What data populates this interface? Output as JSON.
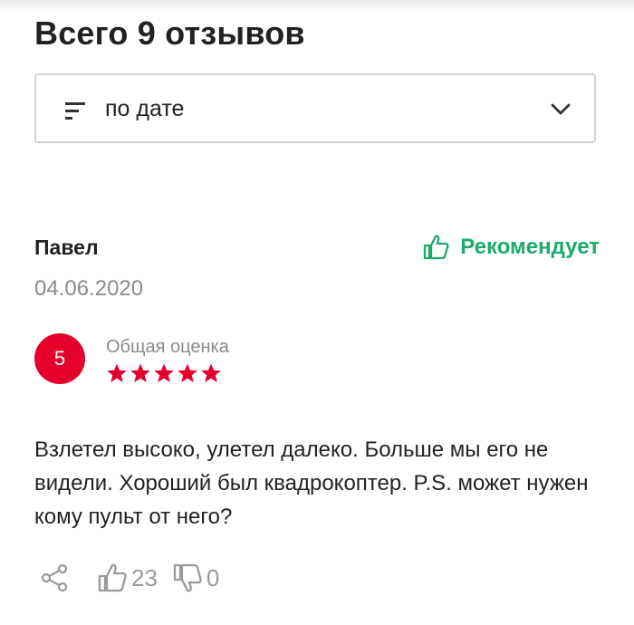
{
  "header": {
    "title": "Всего 9 отзывов"
  },
  "sort": {
    "selected": "по дате"
  },
  "review": {
    "author": "Павел",
    "date": "04.06.2020",
    "recommend_label": "Рекомендует",
    "score": "5",
    "score_label": "Общая оценка",
    "stars": 5,
    "text": "Взлетел высоко, улетел далеко. Больше мы его не видели. Хороший был квадрокоптер. P.S. может нужен кому пульт от него?",
    "likes": "23",
    "dislikes": "0"
  },
  "colors": {
    "accent": "#e4002b",
    "recommend": "#1bab6a",
    "muted": "#8a8a8a"
  },
  "icons": [
    "sort-icon",
    "chevron-down-icon",
    "thumbs-up-icon",
    "star-icon",
    "share-icon",
    "thumbs-down-icon"
  ]
}
